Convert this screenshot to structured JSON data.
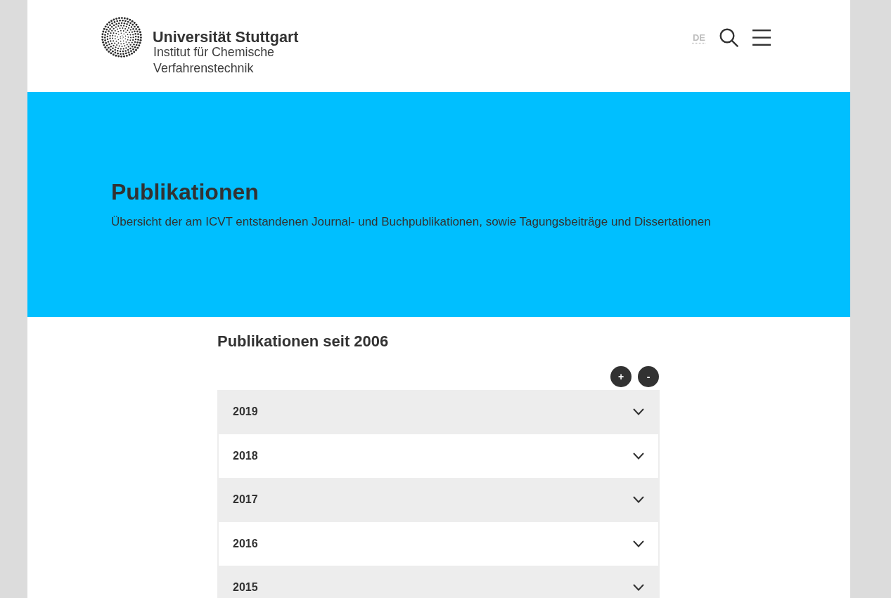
{
  "header": {
    "logo": {
      "name": "Universität Stuttgart",
      "institute": "Institut für Chemische Verfahrenstechnik"
    },
    "language": "DE"
  },
  "hero": {
    "title": "Publikationen",
    "subtitle": "Übersicht der am ICVT entstandenen Journal- und Buchpublikationen, sowie Tagungsbeiträge und Dissertationen"
  },
  "section": {
    "title": "Publikationen seit 2006",
    "controls": [
      "+",
      "-"
    ],
    "years": [
      {
        "label": "2019",
        "expanded": false
      },
      {
        "label": "2018",
        "expanded": false
      },
      {
        "label": "2017",
        "expanded": false
      },
      {
        "label": "2016",
        "expanded": false
      },
      {
        "label": "2015",
        "expanded": false
      }
    ]
  }
}
